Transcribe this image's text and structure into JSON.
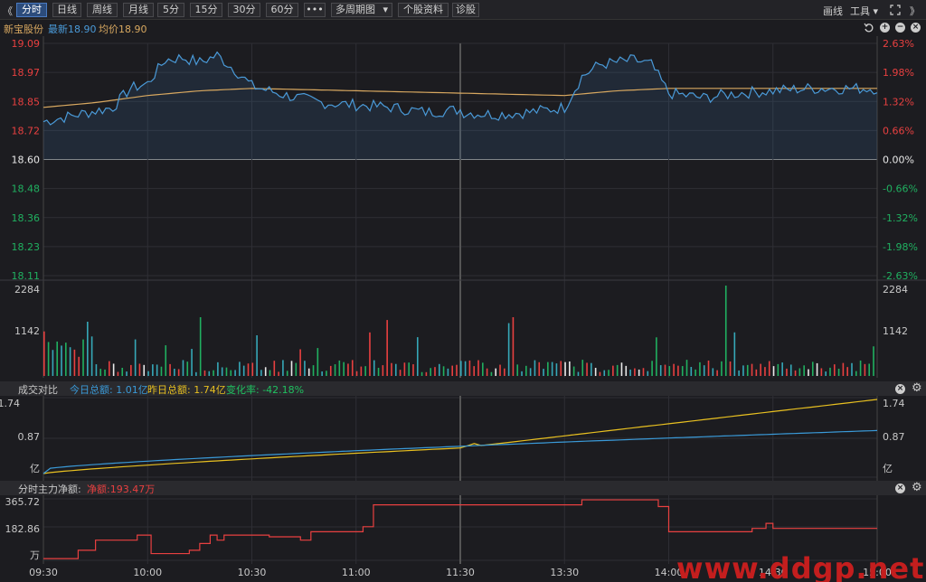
{
  "toolbar": {
    "collapse_left": "《",
    "periods": [
      "分时",
      "日线",
      "周线",
      "月线",
      "5分",
      "15分",
      "30分",
      "60分"
    ],
    "active_period": "分时",
    "more": "•••",
    "multi_period": "多周期图",
    "stock_info": "个股资料",
    "diagnose": "诊股",
    "draw_line": "画线",
    "tools": "工具",
    "collapse_right": "》",
    "icons": [
      "expand-icon",
      "collapse-right-icon"
    ]
  },
  "stock": {
    "name": "新宝股份",
    "latest_label": "最新18.90",
    "avg_label": "均价18.90"
  },
  "price_axis": {
    "left": [
      "19.09",
      "18.97",
      "18.85",
      "18.72",
      "18.60",
      "18.48",
      "18.36",
      "18.23",
      "18.11"
    ],
    "right": [
      "2.63%",
      "1.98%",
      "1.32%",
      "0.66%",
      "0.00%",
      "-0.66%",
      "-1.32%",
      "-1.98%",
      "-2.63%"
    ],
    "prev_close": 18.6,
    "max": 19.09,
    "min": 18.11
  },
  "volume_axis": {
    "top": "2284",
    "mid": "1142"
  },
  "turnover_panel": {
    "title": "成交对比",
    "today_label": "今日总额: 1.01亿",
    "yesterday_label": "昨日总额: 1.74亿",
    "change_label": "变化率: -42.18%",
    "axis_top": "1.74",
    "axis_mid": "0.87",
    "axis_unit": "亿"
  },
  "mainforce_panel": {
    "title": "分时主力净额:",
    "net_label": "净额:193.47万",
    "axis_top": "365.72",
    "axis_mid": "182.86",
    "axis_unit": "万"
  },
  "time_axis": [
    "09:30",
    "10:00",
    "10:30",
    "11:00",
    "11:30",
    "13:30",
    "14:00",
    "14:30",
    "15:00"
  ],
  "watermark": "www.ddgp.net",
  "colors": {
    "price_line": "#4a9ad8",
    "avg_line": "#d8a860",
    "up": "#e84040",
    "down": "#20b060",
    "today": "#3a9ad8",
    "yesterday": "#e8c020",
    "mainforce": "#e84040",
    "flat": "#e8e8e8"
  },
  "chart_data": [
    {
      "type": "line",
      "title": "新宝股份",
      "series": [
        {
          "name": "最新",
          "x": [
            "09:30",
            "09:40",
            "09:50",
            "09:55",
            "10:00",
            "10:05",
            "10:10",
            "10:15",
            "10:20",
            "10:25",
            "10:30",
            "10:40",
            "10:50",
            "11:00",
            "11:10",
            "11:20",
            "11:30",
            "13:00",
            "13:10",
            "13:20",
            "13:30",
            "13:35",
            "13:40",
            "13:45",
            "13:50",
            "13:55",
            "14:00",
            "14:10",
            "14:20",
            "14:30",
            "14:40",
            "14:50",
            "15:00"
          ],
          "y": [
            18.76,
            18.79,
            18.82,
            18.9,
            18.92,
            19.02,
            19.03,
            19.01,
            19.04,
            18.98,
            18.91,
            18.87,
            18.84,
            18.83,
            18.82,
            18.8,
            18.81,
            18.8,
            18.79,
            18.8,
            18.82,
            18.95,
            19.0,
            19.01,
            19.02,
            19.0,
            18.88,
            18.86,
            18.88,
            18.89,
            18.9,
            18.9,
            18.9
          ]
        },
        {
          "name": "均价",
          "x": [
            "09:30",
            "09:45",
            "10:00",
            "10:15",
            "10:30",
            "11:00",
            "11:30",
            "13:30",
            "13:45",
            "14:00",
            "14:30",
            "15:00"
          ],
          "y": [
            18.82,
            18.84,
            18.87,
            18.89,
            18.9,
            18.89,
            18.88,
            18.87,
            18.89,
            18.9,
            18.9,
            18.9
          ]
        }
      ]
    }
  ]
}
